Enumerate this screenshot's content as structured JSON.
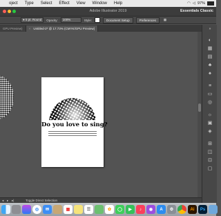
{
  "menubar": {
    "apple": "",
    "items": [
      "oject",
      "Type",
      "Select",
      "Effect",
      "View",
      "Window",
      "Help"
    ],
    "battery": "97%",
    "wifi_icon": "wifi-icon",
    "battery_icon": "battery-icon"
  },
  "titlebar": {
    "title": "Adobe Illustrator 2019",
    "workspace": "Essentials Classic"
  },
  "controlbar": {
    "stroke_profile": "5 pt. Round",
    "opacity_label": "Opacity:",
    "opacity_value": "100%",
    "style_label": "Style:",
    "document_setup": "Document Setup",
    "preferences": "Preferences"
  },
  "tabs": [
    {
      "label": "GPU Preview)",
      "active": false
    },
    {
      "label": "Untitled-2* @ 17.73% (CMYK/GPU Preview)",
      "active": true
    }
  ],
  "artboard": {
    "headline": "Do you love to sing?"
  },
  "statusbar": {
    "text": "Toggle Direct Selection"
  },
  "dock": {
    "apps": [
      "finder",
      "launchpad",
      "siri",
      "safari",
      "mail",
      "contacts",
      "calendar",
      "notes",
      "reminders",
      "maps",
      "photos",
      "messages",
      "facetime",
      "music",
      "podcasts",
      "appstore",
      "preferences",
      "chrome",
      "illustrator",
      "photoshop",
      "folder"
    ],
    "ai_label": "Ai",
    "ps_label": "Ps"
  }
}
